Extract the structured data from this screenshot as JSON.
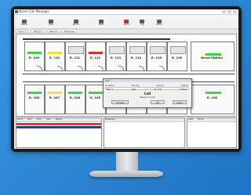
{
  "app": {
    "title": "Nurse Call Manager",
    "menu": [
      "File",
      "View",
      "Tools",
      "Help"
    ]
  },
  "toolbar": {
    "items": [
      {
        "label": "Status",
        "icon": "monitor-icon",
        "red": false
      },
      {
        "label": "Calls",
        "icon": "phone-icon",
        "red": false
      },
      {
        "label": "Rooms",
        "icon": "bed-icon",
        "red": false
      },
      {
        "label": "Staff",
        "icon": "user-icon",
        "red": false
      },
      {
        "label": "Alarm",
        "icon": "alarm-icon",
        "red": true
      },
      {
        "label": "Log",
        "icon": "log-icon",
        "red": false
      },
      {
        "label": "Setup",
        "icon": "gear-icon",
        "red": false
      }
    ]
  },
  "tabs": [
    "Floor 1",
    "Wing A",
    "Ward 2",
    "Overview"
  ],
  "rooms": {
    "r109": "R. 109",
    "r110": "R. 110",
    "r111": "R. 111",
    "r112": "R. 112",
    "r113": "R. 113",
    "r114": "R. 114",
    "r115": "R. 115",
    "r116": "R. 116",
    "r108": "R. 108",
    "r107": "R. 107",
    "r106": "R. 106",
    "r105": "R. 105",
    "r104": "R. 104",
    "r103": "R. 103",
    "r102": "R. 102",
    "r101": "R. 101",
    "r100": "R. 100",
    "nurse": "Nurse Station"
  },
  "colors": {
    "ok": "#3fd14a",
    "pending": "#f1e238",
    "alarm": "#e12b2b",
    "selected": "#1c3cc4"
  },
  "dialog": {
    "title": "Call",
    "columns": [
      "Location",
      "Priority",
      "Device",
      "Status"
    ],
    "row": [
      "Bed 1",
      "Call",
      "R. 112",
      "Active"
    ],
    "call": "Call",
    "sub": "Please accept",
    "btn_accept": "Accept",
    "btn_ok": "OK",
    "btn_close": "Close"
  },
  "panels": {
    "alarms": {
      "cols": [
        "Room",
        "Bed",
        "Time",
        "Type",
        "Status"
      ]
    },
    "messages": {
      "title": "Messages"
    },
    "staff": {
      "cols": [
        "Staff",
        "Room"
      ]
    }
  }
}
